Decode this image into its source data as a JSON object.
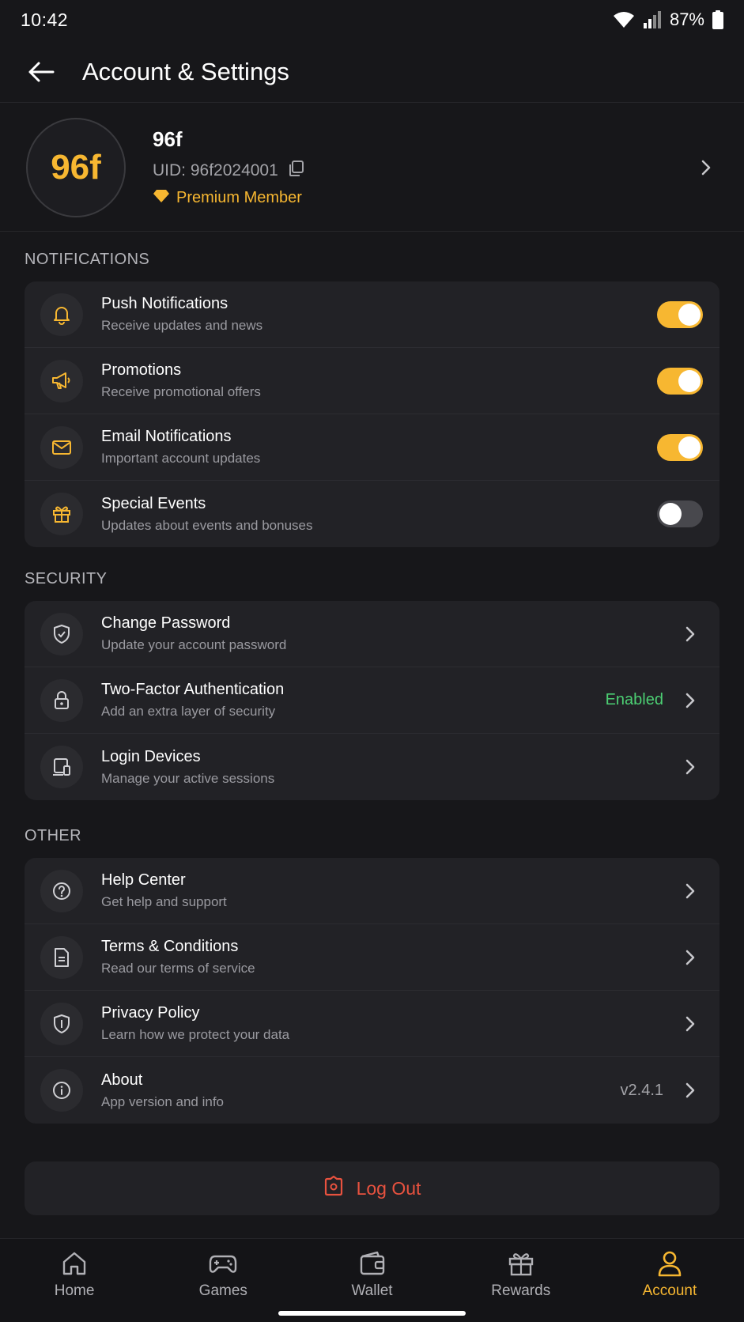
{
  "status_bar": {
    "time": "10:42",
    "battery": "87%"
  },
  "header": {
    "title": "Account & Settings"
  },
  "profile": {
    "avatar_text": "96f",
    "name": "96f",
    "uid": "UID: 96f2024001",
    "badge": "Premium Member"
  },
  "notifications": {
    "title": "NOTIFICATIONS",
    "items": [
      {
        "title": "Push Notifications",
        "subtitle": "Receive updates and news",
        "icon": "bell-icon",
        "enabled": true
      },
      {
        "title": "Promotions",
        "subtitle": "Receive promotional offers",
        "icon": "megaphone-icon",
        "enabled": true
      },
      {
        "title": "Email Notifications",
        "subtitle": "Important account updates",
        "icon": "mail-icon",
        "enabled": true
      },
      {
        "title": "Special Events",
        "subtitle": "Updates about events and bonuses",
        "icon": "gift-icon",
        "enabled": false
      }
    ]
  },
  "security": {
    "title": "SECURITY",
    "items": [
      {
        "title": "Change Password",
        "subtitle": "Update your account password",
        "icon": "shield-check-icon",
        "value": ""
      },
      {
        "title": "Two-Factor Authentication",
        "subtitle": "Add an extra layer of security",
        "icon": "lock-icon",
        "value": "Enabled"
      },
      {
        "title": "Login Devices",
        "subtitle": "Manage your active sessions",
        "icon": "devices-icon",
        "value": ""
      }
    ]
  },
  "other": {
    "title": "OTHER",
    "items": [
      {
        "title": "Help Center",
        "subtitle": "Get help and support",
        "icon": "help-circle-icon",
        "value": ""
      },
      {
        "title": "Terms & Conditions",
        "subtitle": "Read our terms of service",
        "icon": "document-icon",
        "value": ""
      },
      {
        "title": "Privacy Policy",
        "subtitle": "Learn how we protect your data",
        "icon": "shield-icon",
        "value": ""
      },
      {
        "title": "About",
        "subtitle": "App version and info",
        "icon": "info-icon",
        "value": "v2.4.1"
      }
    ]
  },
  "logout": {
    "label": "Log Out"
  },
  "bottom_nav": {
    "items": [
      {
        "label": "Home",
        "icon": "home-icon",
        "active": false
      },
      {
        "label": "Games",
        "icon": "gamepad-icon",
        "active": false
      },
      {
        "label": "Wallet",
        "icon": "wallet-icon",
        "active": false
      },
      {
        "label": "Rewards",
        "icon": "gift-icon",
        "active": false
      },
      {
        "label": "Account",
        "icon": "user-icon",
        "active": true
      }
    ]
  },
  "colors": {
    "accent": "#f7b731",
    "success": "#4ccf73",
    "danger": "#e8523f",
    "background": "#17171a",
    "card": "#222226"
  }
}
